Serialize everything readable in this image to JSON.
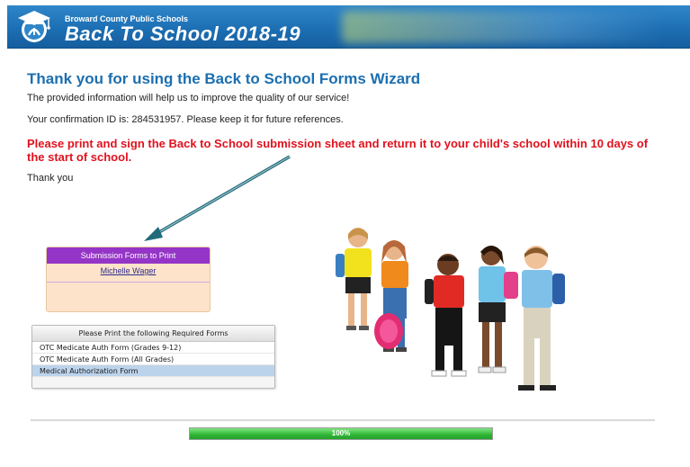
{
  "header": {
    "org": "Broward County Public Schools",
    "title": "Back To School 2018-19"
  },
  "main": {
    "title": "Thank you for using the Back to School Forms Wizard",
    "improve_text": "The provided information will help us to improve the quality of our service!",
    "confirmation_text": "Your confirmation ID is: 284531957. Please keep it for future references.",
    "warning_text": "Please print and sign the Back to School submission sheet and return it to your child's school within 10 days of the start of school.",
    "thanks_text": "Thank you"
  },
  "submission_box": {
    "header": "Submission Forms to Print",
    "name_link": "Michelle Wager"
  },
  "required_forms": {
    "header": "Please Print the following Required Forms",
    "items": [
      {
        "label": "OTC Medicate Auth Form (Grades 9-12)"
      },
      {
        "label": "OTC Medicate Auth Form (All Grades)"
      },
      {
        "label": "Medical Authorization Form"
      }
    ]
  },
  "progress": {
    "label": "100%",
    "value": 1.0
  },
  "colors": {
    "header_blue": "#1d6fb4",
    "title_blue": "#1c6fb0",
    "warning_red": "#e0121e",
    "submission_purple": "#9535c7",
    "progress_green": "#2fb535"
  },
  "icons": {
    "logo": "graduation-cap-logo-icon"
  }
}
